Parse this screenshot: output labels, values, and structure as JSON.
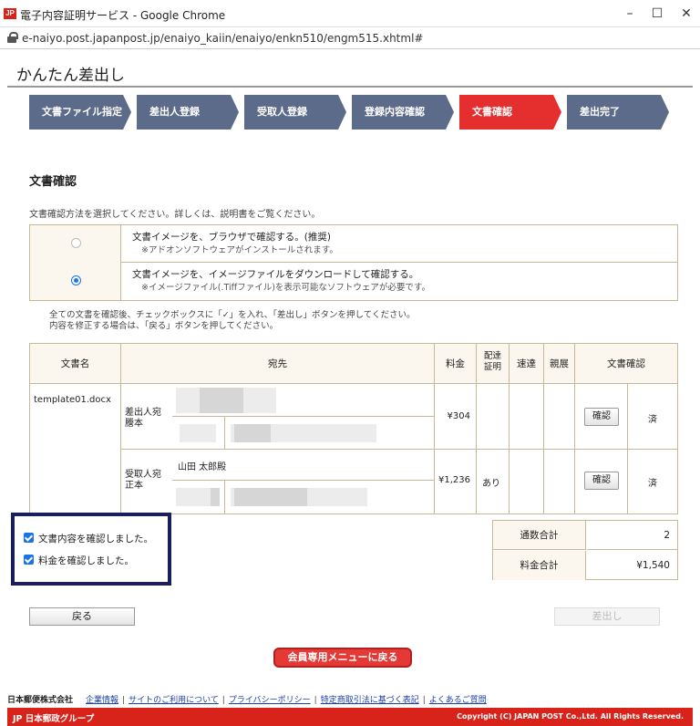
{
  "browser": {
    "window_title": "電子内容証明サービス - Google Chrome",
    "url": "e-naiyo.post.japanpost.jp/enaiyo_kaiin/enaiyo/enkn510/engm515.xhtml#",
    "favicon_text": "JP"
  },
  "page": {
    "title": "かんたん差出し"
  },
  "steps": [
    {
      "label": "文書ファイル指定",
      "active": false
    },
    {
      "label": "差出人登録",
      "active": false
    },
    {
      "label": "受取人登録",
      "active": false
    },
    {
      "label": "登録内容確認",
      "active": false
    },
    {
      "label": "文書確認",
      "active": true
    },
    {
      "label": "差出完了",
      "active": false
    }
  ],
  "section": {
    "title": "文書確認",
    "instruction": "文書確認方法を選択してください。詳しくは、説明書をご覧ください。"
  },
  "options": [
    {
      "label": "文書イメージを、ブラウザで確認する。(推奨)",
      "sub": "※アドオンソフトウェアがインストールされます。",
      "selected": false
    },
    {
      "label": "文書イメージを、イメージファイルをダウンロードして確認する。",
      "sub": "※イメージファイル(.Tiffファイル)を表示可能なソフトウェアが必要です。",
      "selected": true
    }
  ],
  "notes": {
    "line1": "全ての文書を確認後、チェックボックスに「✓」を入れ、「差出し」ボタンを押してください。",
    "line2": "内容を修正する場合は、「戻る」ボタンを押してください。"
  },
  "table": {
    "headers": {
      "doc_name": "文書名",
      "address": "宛先",
      "fee": "料金",
      "delivery_cert_1": "配達",
      "delivery_cert_2": "証明",
      "express": "速達",
      "personal": "親展",
      "doc_confirm": "文書確認"
    },
    "doc_name": "template01.docx",
    "rows": [
      {
        "type_1": "差出人宛",
        "type_2": "謄本",
        "name": "",
        "fee": "¥304",
        "delivery_cert": "",
        "confirm_button": "確認",
        "status": "済"
      },
      {
        "type_1": "受取人宛",
        "type_2": "正本",
        "name": "山田  太郎殿",
        "fee": "¥1,236",
        "delivery_cert": "あり",
        "confirm_button": "確認",
        "status": "済"
      }
    ]
  },
  "checks": [
    {
      "label": "文書内容を確認しました。",
      "checked": true
    },
    {
      "label": "料金を確認しました。",
      "checked": true
    }
  ],
  "totals": {
    "count_label": "通数合計",
    "count_value": "2",
    "fee_label": "料金合計",
    "fee_value": "¥1,540"
  },
  "buttons": {
    "back": "戻る",
    "submit": "差出し",
    "member_menu": "会員専用メニューに戻る"
  },
  "footer": {
    "company": "日本郵便株式会社",
    "links": [
      "企業情報",
      "サイトのご利用について",
      "プライバシーポリシー",
      "特定商取引法に基づく表記",
      "よくあるご質問"
    ],
    "group_logo": "JP 日本郵政グループ",
    "copyright": "Copyright (C) JAPAN POST Co.,Ltd. All Rights Reserved."
  }
}
